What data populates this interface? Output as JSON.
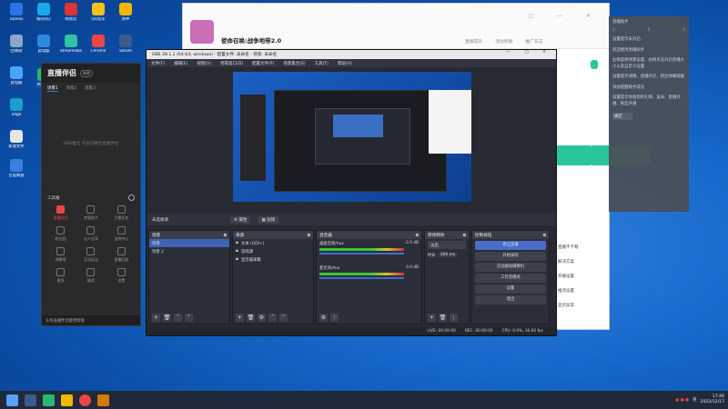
{
  "desktop": {
    "icons": [
      {
        "label": "ToDesk",
        "color": "#2b74e8"
      },
      {
        "label": "腾讯QQ",
        "color": "#1aa7ec"
      },
      {
        "label": "网易云",
        "color": "#d33"
      },
      {
        "label": "回收站",
        "color": "#8aa6c9"
      },
      {
        "label": "此电脑",
        "color": "#2d8ae0"
      },
      {
        "label": "此电脑",
        "color": "#4aa3ff"
      },
      {
        "label": "edge",
        "color": "#17a0c8"
      },
      {
        "label": "新建文件",
        "color": "#e6e6e6"
      },
      {
        "label": "Streamlabs",
        "color": "#31c3a2"
      },
      {
        "label": "Chrome",
        "color": "#e44"
      },
      {
        "label": "原神",
        "color": "#f2b705"
      },
      {
        "label": "QQ音乐",
        "color": "#f6c21a"
      },
      {
        "label": "Steam",
        "color": "#3a5b8c"
      },
      {
        "label": "百度网盘",
        "color": "#3b7de0"
      },
      {
        "label": "网易UU",
        "color": "#2bb673"
      }
    ]
  },
  "live": {
    "brand": "直播伴侣",
    "badge": "体验",
    "tabs": [
      "场景1",
      "场景2",
      "场景3"
    ],
    "scene_hint": "OBS推流   点击切换至直播伴侣",
    "tools_title": "工具箱",
    "tools": [
      {
        "label": "直播伴侣",
        "active": true
      },
      {
        "label": "房管助手",
        "active": false
      },
      {
        "label": "主播任务",
        "active": false
      },
      {
        "label": "粉丝团",
        "active": false
      },
      {
        "label": "达人分享",
        "active": false
      },
      {
        "label": "连线中心",
        "active": false
      },
      {
        "label": "弹幕墙",
        "active": false
      },
      {
        "label": "互动玩法",
        "active": false
      },
      {
        "label": "直播回放",
        "active": false
      },
      {
        "label": "更多",
        "active": false
      },
      {
        "label": "抽奖",
        "active": false
      },
      {
        "label": "设置",
        "active": false
      }
    ],
    "footer": "头条直播伴侣使用帮助"
  },
  "browser": {
    "title": "使命召唤:战争地带2.0",
    "nav": [
      "直播提升",
      "活动奖励",
      "推广日志"
    ],
    "side_links": [
      "直播不卡顿",
      "解决方案",
      "开播设置",
      "推流设置",
      "显示异常"
    ]
  },
  "popup": {
    "title": "直播助手",
    "counts": [
      "0",
      "0",
      "0"
    ],
    "lines": [
      "设置提示未开启",
      "欢迎使用直播助手",
      "左侧选择场景设置，右侧点击开启直播大小以及自定义设置",
      "设置提示请稍，直播开启，粉丝弹幕提醒",
      "添加提醒助手成功"
    ],
    "tail": "设置提示你收到的礼物、送表、直播开通，粉丝开通",
    "ok": "确定"
  },
  "obs": {
    "title": "OBS 28.1.2 (64-bit, windows) - 配置文件: 未命名 - 场景: 未命名",
    "menu": [
      "文件(F)",
      "编辑(E)",
      "视图(V)",
      "停靠窗口(D)",
      "配置文件(P)",
      "场景集合(S)",
      "工具(T)",
      "帮助(H)"
    ],
    "ctx": {
      "source": "未选择源",
      "props": "属性",
      "filters": "滤镜"
    },
    "scenes": {
      "title": "场景",
      "items": [
        "场景",
        "场景 2"
      ]
    },
    "sources": {
      "title": "来源",
      "items": [
        "文本 (GDI+)",
        "游戏源",
        "显示器采集"
      ]
    },
    "mixer": {
      "title": "混音器",
      "channels": [
        {
          "name": "桌面音频/Aux",
          "db": "-3.5 dB"
        },
        {
          "name": "麦克风/Aux",
          "db": "0.0 dB"
        }
      ]
    },
    "transitions": {
      "title": "转场特效",
      "type": "淡出",
      "duration_label": "时长",
      "duration": "300 ms"
    },
    "controls": {
      "title": "控制按钮",
      "buttons": [
        "停止直播",
        "开始录制",
        "启动虚拟摄像机",
        "工作室模式",
        "设置",
        "退出"
      ]
    },
    "status": {
      "live": "LIVE: 00:00:00",
      "rec": "REC: 00:00:00",
      "cpu": "CPU: 0.9%, 30.00 fps"
    }
  },
  "taskbar": {
    "time": "17:46",
    "date": "2022/12/17",
    "lang": "英"
  }
}
